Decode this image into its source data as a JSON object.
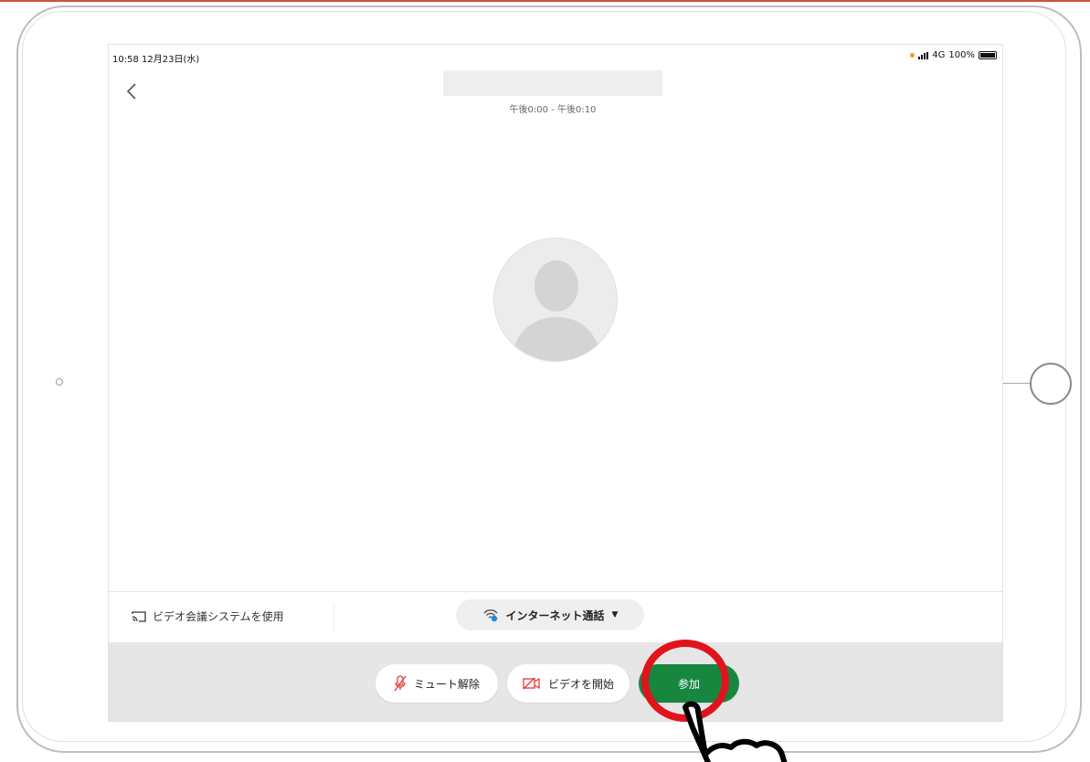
{
  "status_bar": {
    "time_date": "10:58  12月23日(水)",
    "network": "4G",
    "battery": "100%"
  },
  "meeting": {
    "title": "",
    "time_range": "午後0:00 - 午後0:10"
  },
  "options": {
    "video_system_label": "ビデオ会議システムを使用",
    "audio_label": "インターネット通話"
  },
  "controls": {
    "unmute_label": "ミュート解除",
    "start_video_label": "ビデオを開始",
    "join_label": "参加"
  },
  "colors": {
    "join_green": "#17863f",
    "highlight_red": "#e0141d",
    "icon_red": "#e03a3a",
    "wifi_blue": "#1e88e5"
  }
}
